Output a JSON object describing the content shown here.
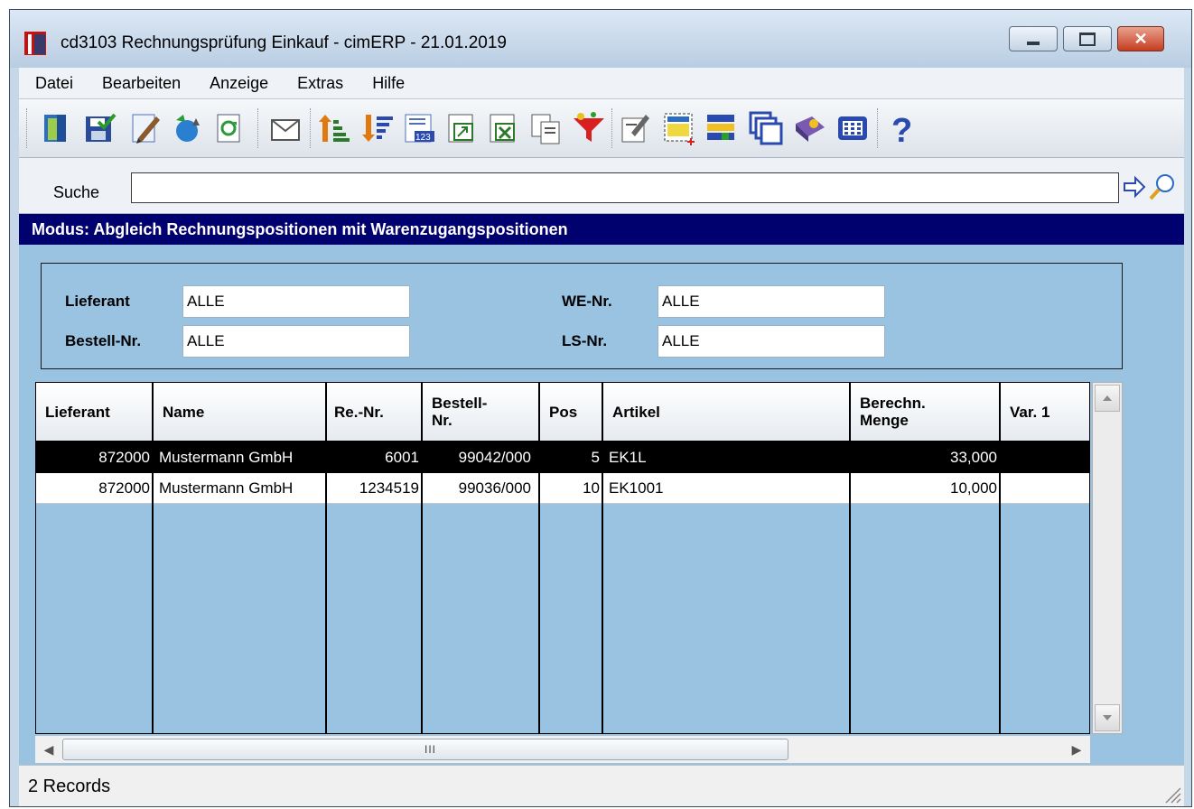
{
  "window": {
    "title": "cd3103 Rechnungsprüfung Einkauf - cimERP - 21.01.2019",
    "controls": [
      "minimize-icon",
      "maximize-icon",
      "close-icon"
    ]
  },
  "menu": {
    "items": [
      "Datei",
      "Bearbeiten",
      "Anzeige",
      "Extras",
      "Hilfe"
    ]
  },
  "toolbar": {
    "icons": [
      "exit-icon",
      "save-icon",
      "edit-icon",
      "recycle-icon",
      "refresh-icon",
      "mail-icon",
      "sort-ascending-icon",
      "sort-descending-icon",
      "numbered-list-icon",
      "export-icon",
      "excel-icon",
      "copy-icon",
      "filter-icon",
      "notes-icon",
      "select-area-icon",
      "import-icon",
      "windows-icon",
      "book-icon",
      "grid-icon",
      "help-icon"
    ]
  },
  "search": {
    "label": "Suche",
    "value": ""
  },
  "mode": {
    "text": "Modus: Abgleich Rechnungspositionen mit Warenzugangspositionen"
  },
  "filters": {
    "lieferant_label": "Lieferant",
    "lieferant_value": "ALLE",
    "bestell_label": "Bestell-Nr.",
    "bestell_value": "ALLE",
    "we_label": "WE-Nr.",
    "we_value": "ALLE",
    "ls_label": "LS-Nr.",
    "ls_value": "ALLE"
  },
  "table": {
    "headers": {
      "lieferant": "Lieferant",
      "name": "Name",
      "renr": "Re.-Nr.",
      "bestell_1": "Bestell-",
      "bestell_2": "Nr.",
      "pos": "Pos",
      "artikel": "Artikel",
      "menge_1": "Berechn.",
      "menge_2": "Menge",
      "var1": "Var. 1"
    },
    "rows": [
      {
        "lieferant": "872000",
        "name": "Mustermann GmbH",
        "renr": "6001",
        "bestell": "99042/000",
        "pos": "5",
        "artikel": "EK1L",
        "menge": "33,000",
        "var1": ""
      },
      {
        "lieferant": "872000",
        "name": "Mustermann GmbH",
        "renr": "1234519",
        "bestell": "99036/000",
        "pos": "10",
        "artikel": "EK1001",
        "menge": "10,000",
        "var1": ""
      }
    ],
    "selected_row": 0
  },
  "scrollbar": {
    "grip": "III"
  },
  "status": {
    "records": "2 Records"
  },
  "colors": {
    "mode_bar": "#00006e",
    "content_bg": "#99c3e1",
    "selected_row": "#000000",
    "logo_red": "#c81010"
  }
}
